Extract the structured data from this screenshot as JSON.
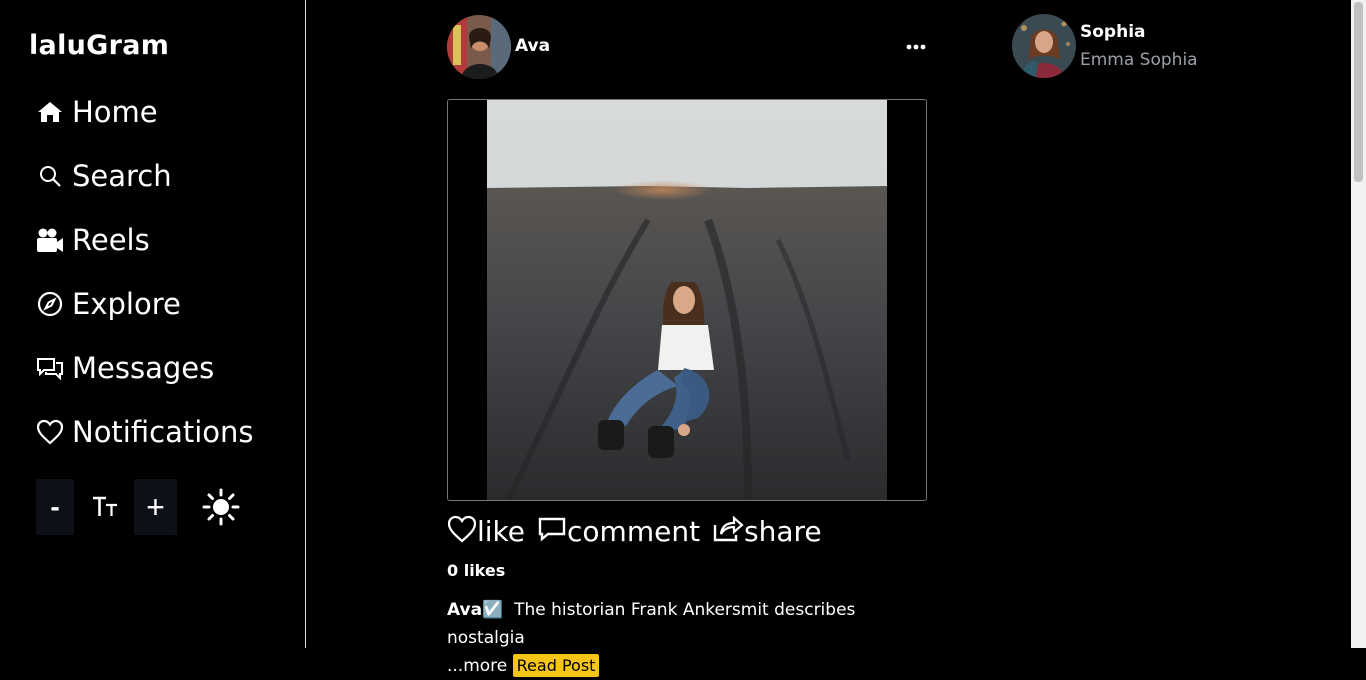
{
  "app": {
    "logo": "laluGram"
  },
  "sidebar": {
    "items": [
      {
        "label": "Home",
        "icon": "home-icon"
      },
      {
        "label": "Search",
        "icon": "search-icon"
      },
      {
        "label": "Reels",
        "icon": "video-camera-icon"
      },
      {
        "label": "Explore",
        "icon": "compass-icon"
      },
      {
        "label": "Messages",
        "icon": "chat-icon"
      },
      {
        "label": "Notifications",
        "icon": "heart-icon"
      }
    ],
    "controls": {
      "decrease": "-",
      "font_icon": "Tт",
      "increase": "+",
      "theme_icon": "sun-icon"
    }
  },
  "post": {
    "author": "Ava",
    "actions": {
      "like": "like",
      "comment": "comment",
      "share": "share"
    },
    "likes": "0 likes",
    "caption_user": "Ava",
    "caption_badge": "☑️",
    "caption_text": "The historian Frank Ankersmit describes nostalgia",
    "more": "...more",
    "read_post": "Read Post"
  },
  "profile": {
    "name": "Sophia",
    "subtitle": "Emma Sophia"
  },
  "colors": {
    "background": "#000000",
    "accent": "#f5c518",
    "muted": "#9aa0a6",
    "control_bg": "#0d1117"
  }
}
